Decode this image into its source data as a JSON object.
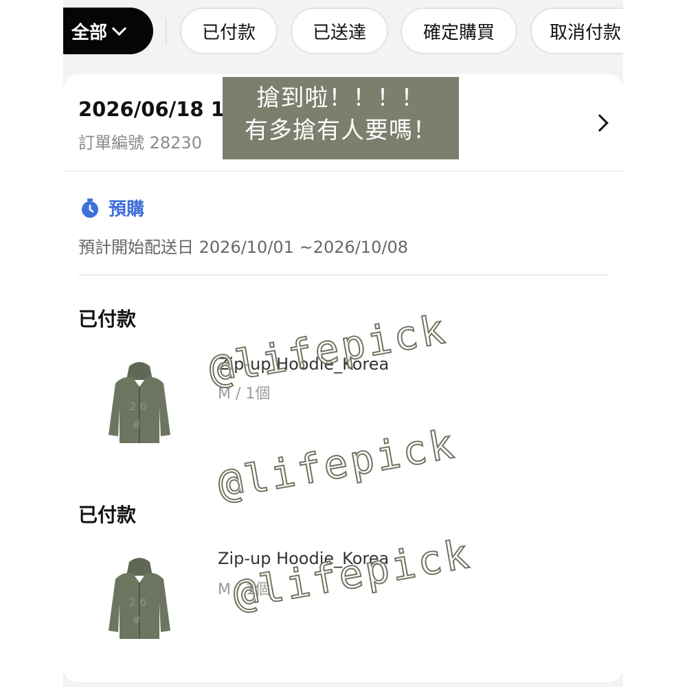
{
  "filters": {
    "all_label": "全部",
    "chips": [
      "已付款",
      "已送達",
      "確定購買",
      "取消付款"
    ]
  },
  "order": {
    "date": "2026/06/18 1",
    "number_label": "訂單編號 28230",
    "preorder_label": "預購",
    "ship_line": "預計開始配送日 2026/10/01 ~2026/10/08"
  },
  "items": [
    {
      "status": "已付款",
      "name": "Zip-up Hoodie_Korea",
      "option": "M / 1個"
    },
    {
      "status": "已付款",
      "name": "Zip-up Hoodie_Korea",
      "option": "M / 1個"
    }
  ],
  "overlay": {
    "line1": "搶到啦！！！！",
    "line2": "有多搶有人要嗎！"
  },
  "watermark": "@lifepick",
  "colors": {
    "accent_blue": "#3f6fd8",
    "overlay_bg": "#7b7f6d",
    "hoodie": "#6b7560"
  }
}
